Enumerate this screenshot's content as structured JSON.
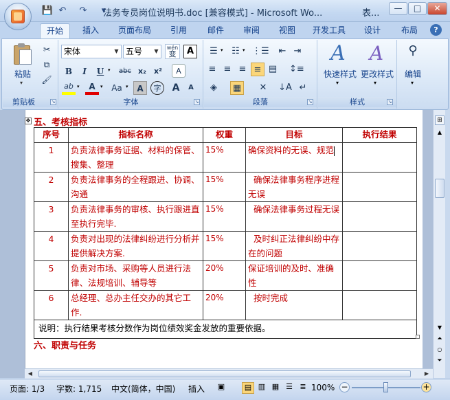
{
  "window": {
    "title": "法务专员岗位说明书.doc [兼容模式] - Microsoft Wo...",
    "title_extra": "表...",
    "minimize": "—",
    "maximize": "□",
    "close": "✕"
  },
  "qat": {
    "save_icon": "💾",
    "undo_icon": "↶",
    "redo_icon": "↷",
    "more_icon": "▾"
  },
  "tabs": [
    "开始",
    "插入",
    "页面布局",
    "引用",
    "邮件",
    "审阅",
    "视图",
    "开发工具",
    "设计",
    "布局"
  ],
  "ribbon": {
    "clipboard": {
      "label": "剪贴板",
      "paste": "粘贴"
    },
    "font": {
      "label": "字体",
      "font_name": "宋体",
      "font_size": "五号",
      "wen": "wén",
      "wen_char": "变",
      "A_box": "A",
      "bold": "B",
      "italic": "I",
      "underline": "U",
      "strike": "abc",
      "sub": "x₂",
      "sup": "x²",
      "clear": "A",
      "highlight": "ab",
      "fontcolor": "A",
      "case": "Aa",
      "shade": "A",
      "enclose": "字",
      "grow": "A",
      "shrink": "A"
    },
    "paragraph": {
      "label": "段落"
    },
    "styles": {
      "label": "样式",
      "quick": "快速样式",
      "change": "更改样式"
    },
    "editing": {
      "label": "编辑"
    }
  },
  "document": {
    "section5_heading": "五、考核指标",
    "table": {
      "headers": [
        "序号",
        "指标名称",
        "权重",
        "目标",
        "执行结果"
      ],
      "rows": [
        {
          "no": "1",
          "name": "负责法律事务证据、材料的保管、搜集、整理",
          "weight": "15%",
          "goal": "确保资料的无误、规范",
          "result": ""
        },
        {
          "no": "2",
          "name": "负责法律事务的全程跟进、协调、沟通",
          "weight": "15%",
          "goal": "  确保法律事务程序进程无误",
          "result": ""
        },
        {
          "no": "3",
          "name": "负责法律事务的审核、执行跟进直至执行完毕.",
          "weight": "15%",
          "goal": "  确保法律事务过程无误",
          "result": ""
        },
        {
          "no": "4",
          "name": "负责对出现的法律纠纷进行分析并提供解决方案.",
          "weight": "15%",
          "goal": "  及时纠正法律纠纷中存在的问题",
          "result": ""
        },
        {
          "no": "5",
          "name": "负责对市场、采购等人员进行法律、法规培训、辅导等",
          "weight": "20%",
          "goal": "保证培训的及时、准确性",
          "result": ""
        },
        {
          "no": "6",
          "name": "总经理、总办主任交办的其它工作.",
          "weight": "20%",
          "goal": "  按时完成",
          "result": ""
        }
      ],
      "note": "说明：执行结果考核分数作为岗位绩效奖金发放的重要依据。"
    },
    "section6_heading": "六、职责与任务"
  },
  "status": {
    "page": "页面: 1/3",
    "words": "字数: 1,715",
    "lang": "中文(简体，中国)",
    "insert": "插入",
    "zoom": "100%"
  },
  "colors": {
    "doc_text": "#c00000",
    "accent": "#15428b"
  }
}
